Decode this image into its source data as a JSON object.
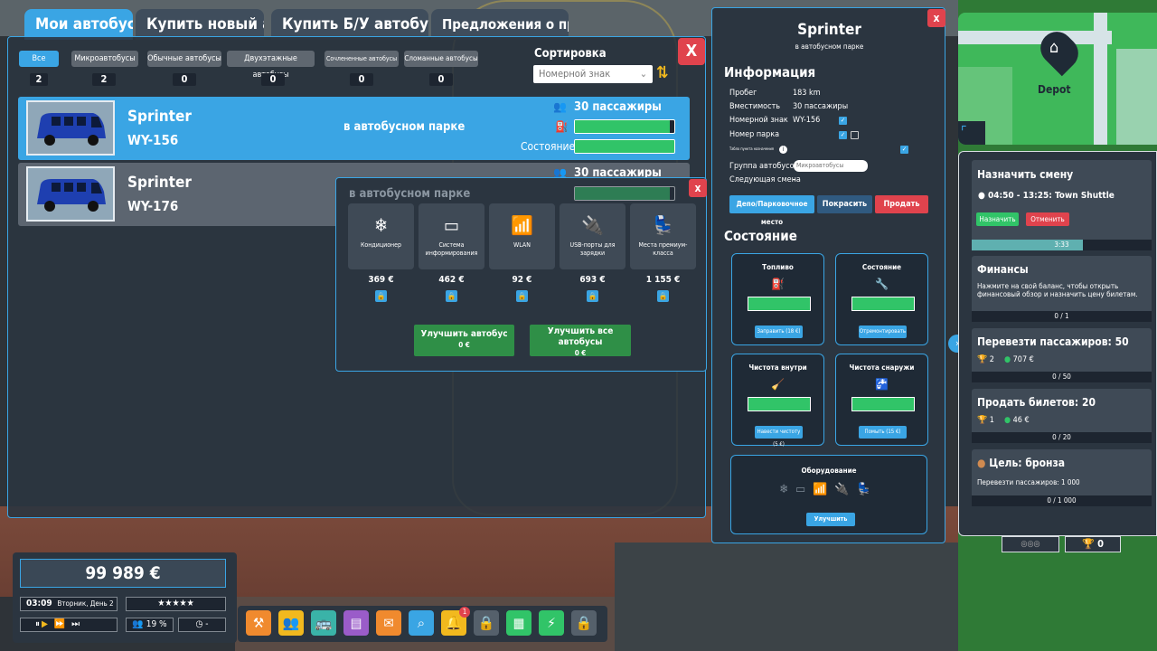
{
  "tabs": [
    "Мои автобусы",
    "Купить новый автобус",
    "Купить Б/У автобус",
    "Предложения о продаже"
  ],
  "filters": [
    {
      "label": "Все",
      "count": "2"
    },
    {
      "label": "Микроавтобусы",
      "count": "2"
    },
    {
      "label": "Обычные автобусы",
      "count": "0"
    },
    {
      "label": "Двухэтажные автобусы",
      "count": "0"
    },
    {
      "label": "Сочлененные автобусы",
      "count": "0"
    },
    {
      "label": "Сломанные автобусы",
      "count": "0"
    }
  ],
  "sort": {
    "label": "Сортировка",
    "value": "Номерной знак",
    "close": "X"
  },
  "buses": [
    {
      "name": "Sprinter",
      "plate": "WY-156",
      "location": "в автобусном парке",
      "passengers": "30 пассажиры",
      "condition_label": "Состояние",
      "fuel": 0.95,
      "condition": 1.0
    },
    {
      "name": "Sprinter",
      "plate": "WY-176",
      "location": "в автобусном парке",
      "passengers": "30 пассажиры",
      "condition_label": "Состояние",
      "fuel": 0.95,
      "condition": 1.0
    }
  ],
  "upgrades": {
    "close": "x",
    "items": [
      {
        "label": "Кондиционер",
        "price": "369 €",
        "icon": "air-conditioner-icon"
      },
      {
        "label": "Система информирования",
        "price": "462 €",
        "icon": "monitor-icon"
      },
      {
        "label": "WLAN",
        "price": "92 €",
        "icon": "router-icon"
      },
      {
        "label": "USB-порты для зарядки",
        "price": "693 €",
        "icon": "usb-icon"
      },
      {
        "label": "Места премиум-класса",
        "price": "1 155 €",
        "icon": "seat-icon"
      }
    ],
    "upgrade_btn": "Улучшить автобус",
    "upgrade_btn_price": "0 €",
    "upgrade_all_btn": "Улучшить все автобусы",
    "upgrade_all_price": "0 €"
  },
  "info": {
    "title": "Sprinter",
    "subtitle": "в автобусном парке",
    "close": "x",
    "section_info": "Информация",
    "rows": [
      {
        "k": "Пробег",
        "v": "183 km"
      },
      {
        "k": "Вместимость",
        "v": "30 пассажиры"
      },
      {
        "k": "Номерной знак",
        "v": "WY-156"
      },
      {
        "k": "Номер парка",
        "v": ""
      }
    ],
    "tiny_row": "Табло пункта назначения",
    "group_label": "Группа автобусов",
    "group_value": "Микроавтобусы",
    "next_shift_label": "Следующая смена",
    "next_shift_value": "-",
    "btn_depot": "Депо/Парковочное место",
    "btn_paint": "Покрасить",
    "btn_sell": "Продать",
    "section_state": "Состояние",
    "stats": [
      {
        "title": "Топливо",
        "action": "Заправить (18 €)",
        "icon": "fuel-icon"
      },
      {
        "title": "Состояние",
        "action": "Отремонтировать",
        "icon": "wrench-icon"
      },
      {
        "title": "Чистота внутри",
        "action": "Навести чистоту (5 €)",
        "icon": "broom-icon"
      },
      {
        "title": "Чистота снаружи",
        "action": "Помыть (15 €)",
        "icon": "tap-icon"
      }
    ],
    "equipment_title": "Оборудование",
    "equipment_btn": "Улучшить"
  },
  "map": {
    "label": "Depot"
  },
  "tasks": {
    "shift": {
      "title": "Назначить смену",
      "time": "04:50 - 13:25: Town Shuttle",
      "assign": "Назначить",
      "cancel": "Отменить",
      "progress_text": "3:33",
      "progress": 0.33
    },
    "finance": {
      "title": "Финансы",
      "desc": "Нажмите на свой баланс, чтобы открыть финансовый обзор и назначить цену билетам.",
      "progress_text": "0 / 1"
    },
    "passengers": {
      "title": "Перевезти пассажиров: 50",
      "trophy": "2",
      "money": "707 €",
      "progress_text": "0 / 50"
    },
    "tickets": {
      "title": "Продать билетов: 20",
      "trophy": "1",
      "money": "46 €",
      "progress_text": "0 / 20"
    },
    "goal": {
      "title": "Цель: бронза",
      "desc": "Перевезти пассажиров: 1 000",
      "progress_text": "0 / 1 000"
    },
    "trophies_count": "0"
  },
  "hud": {
    "money": "99 989 €",
    "time": "03:09",
    "day": "Вторник, День 2",
    "stars": "★★★★★",
    "satisfaction": "19 %",
    "timer": "-"
  },
  "toolbar": {
    "notification_count": "1",
    "buttons": [
      {
        "name": "build-button",
        "icon": "⚒",
        "color": "#f08a2e"
      },
      {
        "name": "staff-button",
        "icon": "👥",
        "color": "#f2b91e"
      },
      {
        "name": "buses-button",
        "icon": "🚌",
        "color": "#3ab3a8"
      },
      {
        "name": "statistics-button",
        "icon": "▤",
        "color": "#9a5cc9"
      },
      {
        "name": "finances-button",
        "icon": "✉",
        "color": "#f08a2e"
      },
      {
        "name": "search-button",
        "icon": "⌕",
        "color": "#3aa5e4"
      },
      {
        "name": "notifications-button",
        "icon": "🔔",
        "color": "#f2b91e"
      },
      {
        "name": "locked-button-1",
        "icon": "🔒",
        "color": "#55606b"
      },
      {
        "name": "documents-button",
        "icon": "▦",
        "color": "#31c468"
      },
      {
        "name": "energy-button",
        "icon": "⚡",
        "color": "#31c468"
      },
      {
        "name": "locked-button-2",
        "icon": "🔒",
        "color": "#55606b"
      }
    ]
  }
}
